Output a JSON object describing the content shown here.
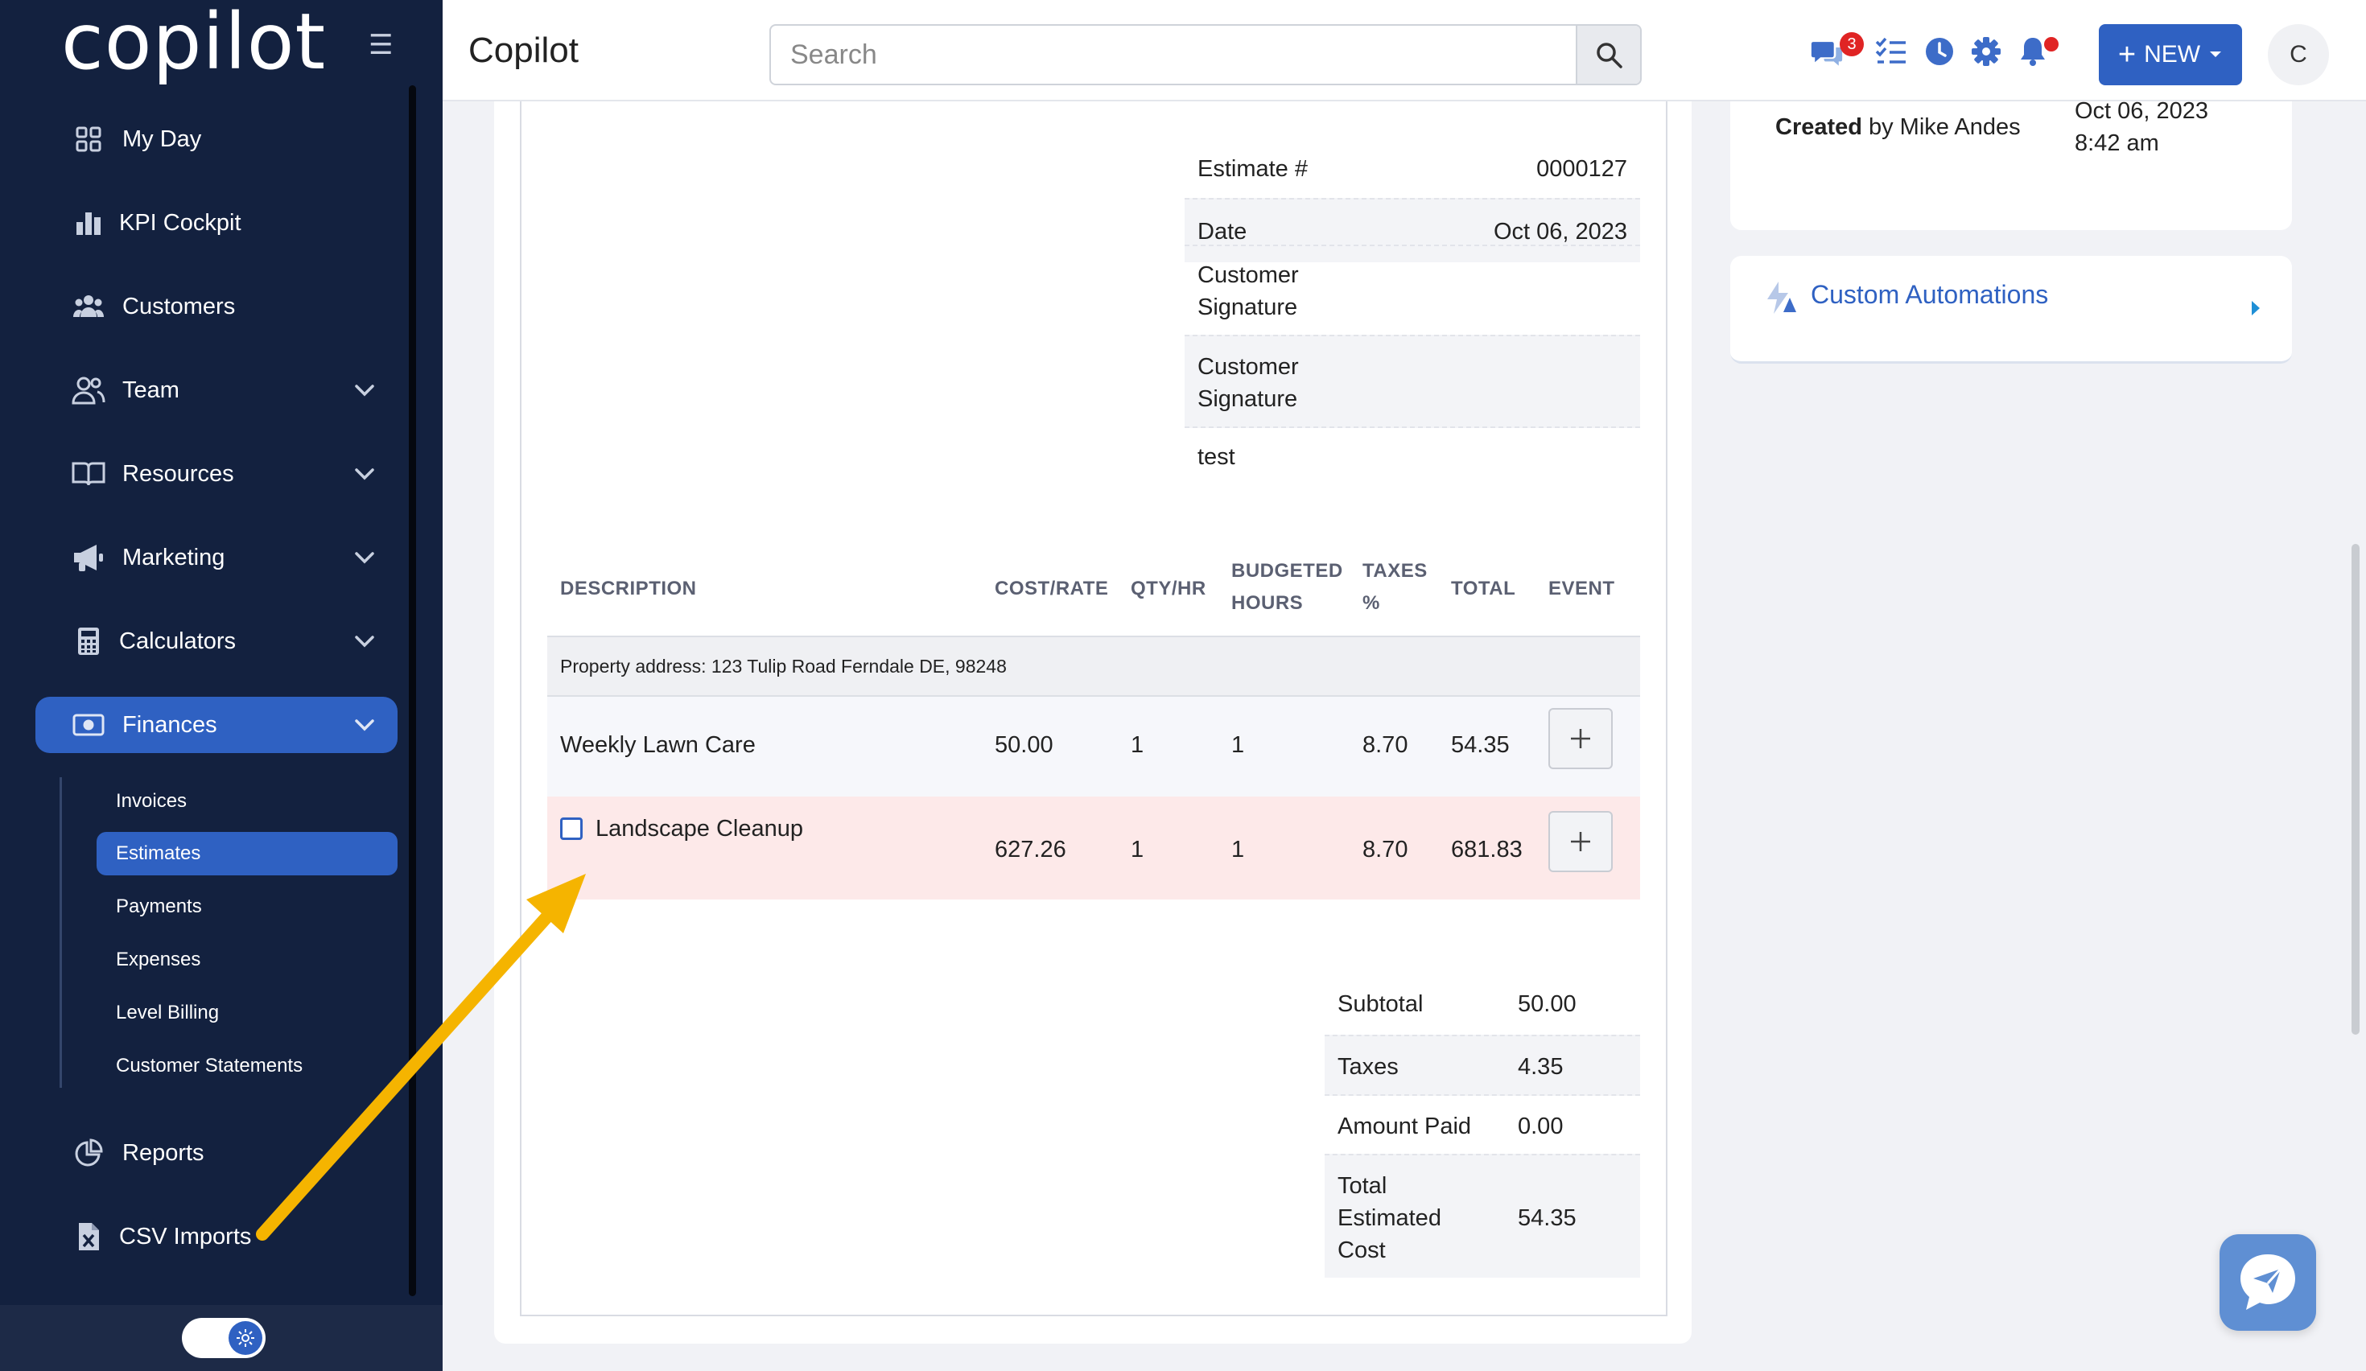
{
  "sidebar": {
    "logo": "copilot",
    "items": [
      {
        "label": "My Day"
      },
      {
        "label": "KPI Cockpit"
      },
      {
        "label": "Customers"
      },
      {
        "label": "Team"
      },
      {
        "label": "Resources"
      },
      {
        "label": "Marketing"
      },
      {
        "label": "Calculators"
      },
      {
        "label": "Finances"
      },
      {
        "label": "Reports"
      },
      {
        "label": "CSV Imports"
      }
    ],
    "finances_sub": [
      {
        "label": "Invoices"
      },
      {
        "label": "Estimates"
      },
      {
        "label": "Payments"
      },
      {
        "label": "Expenses"
      },
      {
        "label": "Level Billing"
      },
      {
        "label": "Customer Statements"
      }
    ]
  },
  "header": {
    "title": "Copilot",
    "search_placeholder": "Search",
    "chat_badge": "3",
    "new_label": "NEW",
    "avatar_initial": "C"
  },
  "estimate": {
    "fields": [
      {
        "key": "Estimate #",
        "value": "0000127"
      },
      {
        "key": "Date",
        "value": "Oct 06, 2023"
      },
      {
        "key": "Customer\nSignature",
        "value": ""
      },
      {
        "key": "Customer\nSignature",
        "value": ""
      },
      {
        "key": "test",
        "value": ""
      }
    ],
    "columns": [
      "DESCRIPTION",
      "COST/RATE",
      "QTY/HR",
      "BUDGETED HOURS",
      "TAXES %",
      "TOTAL",
      "EVENT"
    ],
    "property_address": "Property address: 123 Tulip Road Ferndale DE, 98248",
    "rows": [
      {
        "description": "Weekly Lawn Care",
        "cost": "50.00",
        "qty": "1",
        "hours": "1",
        "taxes": "8.70",
        "total": "54.35"
      },
      {
        "description": "Landscape Cleanup",
        "cost": "627.26",
        "qty": "1",
        "hours": "1",
        "taxes": "8.70",
        "total": "681.83"
      }
    ],
    "totals": [
      {
        "label": "Subtotal",
        "value": "50.00"
      },
      {
        "label": "Taxes",
        "value": "4.35"
      },
      {
        "label": "Amount Paid",
        "value": "0.00"
      },
      {
        "label": "Total\nEstimated\nCost",
        "value": "54.35"
      }
    ]
  },
  "right_panel": {
    "created_label": "Created",
    "created_by": "by Mike Andes",
    "created_date": "Oct 06, 2023",
    "created_time": "8:42 am",
    "automations_label": "Custom Automations"
  },
  "colors": {
    "sidebar_bg": "#13213f",
    "accent": "#2f61c2",
    "highlight_row": "#fde9e9",
    "annotation_arrow": "#f5b400"
  }
}
